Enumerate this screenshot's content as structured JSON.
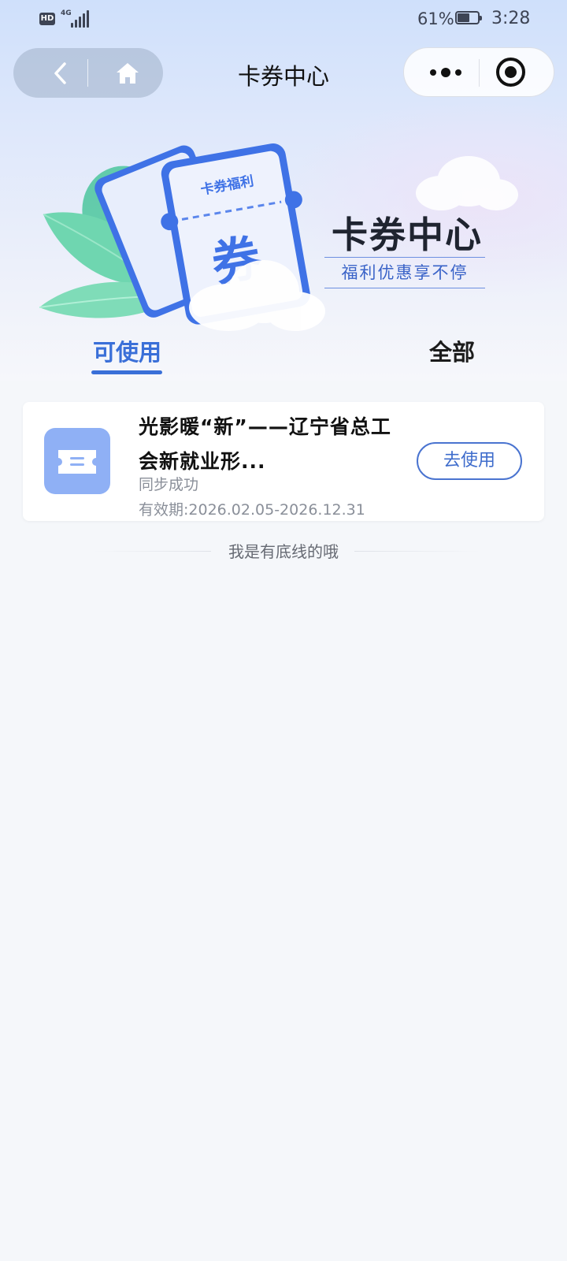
{
  "status_bar": {
    "hd_badge": "HD",
    "network": "4G",
    "battery_percent": "61%",
    "time": "3:28"
  },
  "nav": {
    "title": "卡券中心"
  },
  "banner": {
    "ticket_label": "卡券福利",
    "ticket_char": "券",
    "title": "卡券中心",
    "subtitle": "福利优惠享不停"
  },
  "tabs": [
    {
      "label": "可使用",
      "active": true
    },
    {
      "label": "全部",
      "active": false
    }
  ],
  "coupons": [
    {
      "title": "光影暖“新”——辽宁省总工会新就业形...",
      "status": "同步成功",
      "validity_label": "有效期:",
      "validity": "2026.02.05-2026.12.31",
      "action": "去使用"
    }
  ],
  "footer_note": "我是有底线的哦",
  "colors": {
    "accent": "#3a6fd8",
    "coupon_icon_bg": "#8fb0f5",
    "page_bg": "#f5f7fa"
  }
}
